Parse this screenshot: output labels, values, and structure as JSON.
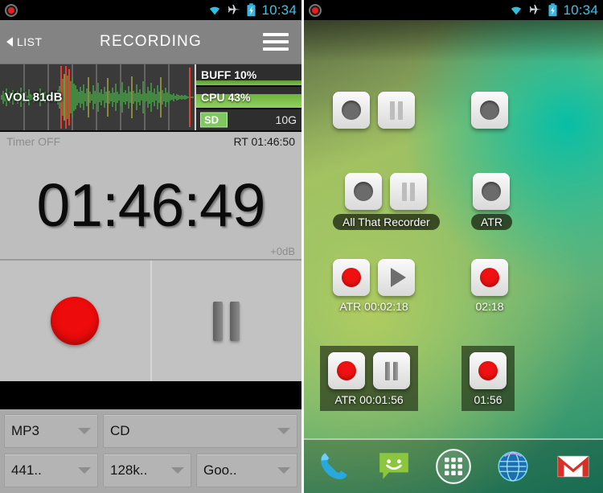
{
  "left_phone": {
    "statusbar": {
      "notification_icon": "recording-notification-icon",
      "wifi_icon": "wifi-icon",
      "airplane_icon": "airplane-mode-icon",
      "battery_icon": "battery-charging-icon",
      "clock": "10:34",
      "clock_color": "#3cc3e8"
    },
    "header": {
      "back_label": "LIST",
      "title": "RECORDING",
      "menu_icon": "hamburger-menu-icon"
    },
    "meter": {
      "vol_label": "VOL 81dB",
      "stats": [
        {
          "label": "BUFF 10%",
          "value": "",
          "percent": 10
        },
        {
          "label": "CPU 43%",
          "value": "",
          "percent": 100
        },
        {
          "label": "SD",
          "value": "10G",
          "percent": 0
        }
      ]
    },
    "timer_strip": {
      "timer": "Timer OFF",
      "remaining": "RT 01:46:50"
    },
    "clock": {
      "elapsed": "01:46:49",
      "gain": "+0dB"
    },
    "transport": {
      "record_icon": "record-button",
      "pause_icon": "pause-button"
    },
    "spinners": [
      {
        "name": "format",
        "value": "MP3"
      },
      {
        "name": "quality",
        "value": "CD"
      },
      {
        "name": "samplerate",
        "value": "441.."
      },
      {
        "name": "bitrate",
        "value": "128k.."
      },
      {
        "name": "encoder",
        "value": "Goo.."
      }
    ]
  },
  "right_phone": {
    "statusbar": {
      "notification_icon": "recording-notification-icon",
      "wifi_icon": "wifi-icon",
      "airplane_icon": "airplane-mode-icon",
      "battery_icon": "battery-charging-icon",
      "clock": "10:34"
    },
    "widgets": [
      {
        "id": "w1",
        "buttons": [
          "record-off",
          "pause-off"
        ],
        "label": "",
        "panel": false
      },
      {
        "id": "w2",
        "buttons": [
          "record-off"
        ],
        "label": "",
        "panel": false
      },
      {
        "id": "w3",
        "buttons": [
          "record-off",
          "pause-off"
        ],
        "label": "All That Recorder",
        "label_style": "pill",
        "panel": false
      },
      {
        "id": "w4",
        "buttons": [
          "record-off"
        ],
        "label": "ATR",
        "label_style": "pill",
        "panel": false
      },
      {
        "id": "w5",
        "buttons": [
          "record-on",
          "play"
        ],
        "label": "ATR 00:02:18",
        "label_style": "plain",
        "panel": false
      },
      {
        "id": "w6",
        "buttons": [
          "record-on"
        ],
        "label": "02:18",
        "label_style": "plain",
        "panel": false
      },
      {
        "id": "w7",
        "buttons": [
          "record-on",
          "pause-dark"
        ],
        "label": "ATR 00:01:56",
        "label_style": "plain",
        "panel": true
      },
      {
        "id": "w8",
        "buttons": [
          "record-on"
        ],
        "label": "01:56",
        "label_style": "plain",
        "panel": true
      }
    ],
    "dock": [
      {
        "name": "phone-icon"
      },
      {
        "name": "messaging-icon"
      },
      {
        "name": "app-drawer-icon"
      },
      {
        "name": "browser-icon"
      },
      {
        "name": "gmail-icon"
      }
    ]
  }
}
